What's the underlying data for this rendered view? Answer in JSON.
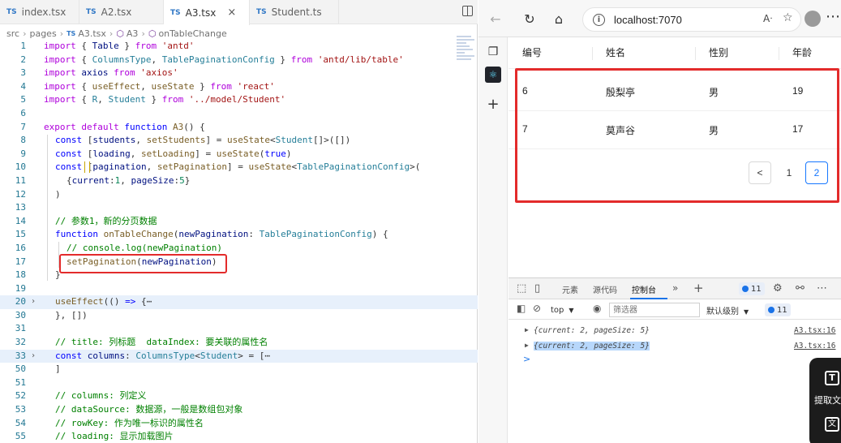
{
  "editor": {
    "tabs": [
      {
        "icon": "TS",
        "label": "index.tsx"
      },
      {
        "icon": "TS",
        "label": "A2.tsx"
      },
      {
        "icon": "TS",
        "label": "A3.tsx",
        "close": "×"
      },
      {
        "icon": "TS",
        "label": "Student.ts"
      }
    ],
    "breadcrumb": [
      "src",
      "pages",
      "A3.tsx",
      "A3",
      "onTableChange"
    ],
    "lines": [
      {
        "n": "1"
      },
      {
        "n": "2"
      },
      {
        "n": "3"
      },
      {
        "n": "4"
      },
      {
        "n": "5"
      },
      {
        "n": "6"
      },
      {
        "n": "7"
      },
      {
        "n": "8"
      },
      {
        "n": "9"
      },
      {
        "n": "10"
      },
      {
        "n": "11"
      },
      {
        "n": "12"
      },
      {
        "n": "13"
      },
      {
        "n": "14"
      },
      {
        "n": "15"
      },
      {
        "n": "16"
      },
      {
        "n": "17"
      },
      {
        "n": "18"
      },
      {
        "n": "19"
      },
      {
        "n": "20"
      },
      {
        "n": "30"
      },
      {
        "n": "31"
      },
      {
        "n": "32"
      },
      {
        "n": "33"
      },
      {
        "n": "50"
      },
      {
        "n": "51"
      },
      {
        "n": "52"
      },
      {
        "n": "53"
      },
      {
        "n": "54"
      },
      {
        "n": "55"
      }
    ],
    "code": {
      "l1": [
        "import",
        " { ",
        "Table",
        " } ",
        "from",
        " ",
        "'antd'"
      ],
      "l2": [
        "import",
        " { ",
        "ColumnsType",
        ", ",
        "TablePaginationConfig",
        " } ",
        "from",
        " ",
        "'antd/lib/table'"
      ],
      "l3": [
        "import",
        " ",
        "axios",
        " ",
        "from",
        " ",
        "'axios'"
      ],
      "l4": [
        "import",
        " { ",
        "useEffect",
        ", ",
        "useState",
        " } ",
        "from",
        " ",
        "'react'"
      ],
      "l5": [
        "import",
        " { ",
        "R",
        ", ",
        "Student",
        " } ",
        "from",
        " ",
        "'../model/Student'"
      ],
      "l7": [
        "export",
        " ",
        "default",
        " ",
        "function",
        " ",
        "A3",
        "() {"
      ],
      "l8": [
        "const",
        " [",
        "students",
        ", ",
        "setStudents",
        "] = ",
        "useState",
        "<",
        "Student",
        "[]>([])"
      ],
      "l9": [
        "const",
        " [",
        "loading",
        ", ",
        "setLoading",
        "] = ",
        "useState",
        "(",
        "true",
        ")"
      ],
      "l10": [
        "const",
        " [",
        "pagination",
        ", ",
        "setPagination",
        "] = ",
        "useState",
        "<",
        "TablePaginationConfig",
        ">("
      ],
      "l11": [
        "{",
        "current",
        ":",
        "1",
        ", ",
        "pageSize",
        ":",
        "5",
        "}"
      ],
      "l12": [
        ")"
      ],
      "l14": [
        "// 参数1，新的分页数据"
      ],
      "l15": [
        "function",
        " ",
        "onTableChange",
        "(",
        "newPagination",
        ": ",
        "TablePaginationConfig",
        ") {"
      ],
      "l16": [
        "// console.log(newPagination)"
      ],
      "l17": [
        "setPagination",
        "(",
        "newPagination",
        ")"
      ],
      "l18": [
        "}"
      ],
      "l20": [
        "useEffect",
        "(() ",
        "=>",
        " {",
        "⋯"
      ],
      "l30": [
        "}, [])"
      ],
      "l32": [
        "// title: 列标题  dataIndex: 要关联的属性名"
      ],
      "l33": [
        "const",
        " ",
        "columns",
        ": ",
        "ColumnsType",
        "<",
        "Student",
        "> = [",
        "⋯"
      ],
      "l50": [
        "]"
      ],
      "l52": [
        "// columns: 列定义"
      ],
      "l53": [
        "// dataSource: 数据源，一般是数组包对象"
      ],
      "l54": [
        "// rowKey: 作为唯一标识的属性名"
      ],
      "l55": [
        "// loading: 显示加载图片"
      ]
    }
  },
  "browser": {
    "url": "localhost:7070",
    "table": {
      "headers": [
        "编号",
        "姓名",
        "性别",
        "年龄"
      ],
      "rows": [
        [
          "6",
          "殷梨亭",
          "男",
          "19"
        ],
        [
          "7",
          "莫声谷",
          "男",
          "17"
        ]
      ],
      "pagination": {
        "prev": "<",
        "pages": [
          "1",
          "2"
        ],
        "current_page": "2"
      }
    },
    "devtools": {
      "tabs": [
        "元素",
        "源代码",
        "控制台"
      ],
      "active_tab": "控制台",
      "issue_count": "11",
      "context": "top",
      "filter_placeholder": "筛选器",
      "level": "默认级别",
      "logs": [
        {
          "text": "{current: 2, pageSize: 5}",
          "source": "A3.tsx:16"
        },
        {
          "text": "{current: 2, pageSize: 5}",
          "source": "A3.tsx:16"
        }
      ],
      "prompt": ">"
    }
  },
  "overlay": {
    "label": "提取文字"
  },
  "colors": {
    "highlight_red": "#e32b2b",
    "accent_blue": "#1677ff",
    "ts_blue": "#3178c6"
  }
}
